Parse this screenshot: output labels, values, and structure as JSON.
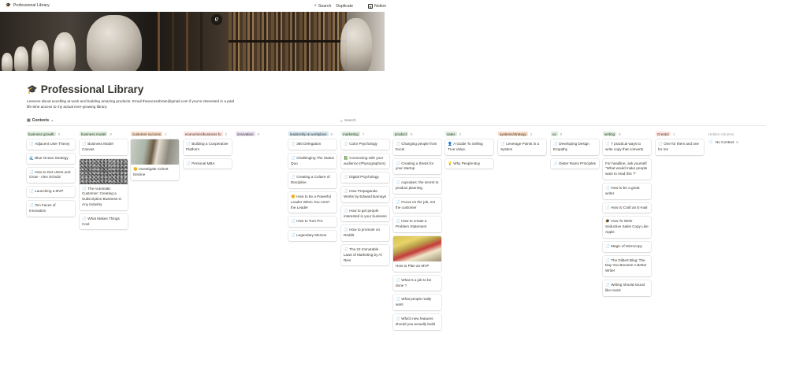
{
  "topbar": {
    "page_title": "Professional Library",
    "search": "Search",
    "duplicate": "Duplicate",
    "notion": "Notion"
  },
  "page": {
    "title": "Professional Library",
    "description": "Lessons about excelling at work and building amazing products. Email theexcessbrain@gmail.com if you're interested in a paid life-time access to my actual ever-growing library."
  },
  "view": {
    "label": "Contexts",
    "search": "Search"
  },
  "columns": [
    {
      "name": "business growth",
      "count": "3",
      "color": "#dbeddb",
      "cards": [
        {
          "text": "Adjacent User Theory",
          "icon": "page"
        },
        {
          "text": "Blue Ocean Strategy",
          "icon": "wave"
        },
        {
          "text": "How to Get Users and Grow - Alex Schultz",
          "icon": "page"
        },
        {
          "text": "Launching a MVP",
          "icon": "page"
        },
        {
          "text": "Ten Faces of Innovation",
          "icon": "page"
        }
      ]
    },
    {
      "name": "business model",
      "count": "3",
      "color": "#dbeddb",
      "cards": [
        {
          "text": "Business Model Canvas",
          "icon": "page"
        },
        {
          "text": "The Automatic Customer: Creating a Subscription Business in Any Industry",
          "icon": "page",
          "image": "gravel"
        },
        {
          "text": "What Makes Things Cool",
          "icon": "page"
        }
      ]
    },
    {
      "name": "customer success",
      "count": "1",
      "color": "#fadec9",
      "cards": [
        {
          "text": "Investigate Cohort Decline",
          "icon": "smile",
          "image": "money"
        }
      ]
    },
    {
      "name": "economics/business fu",
      "count": "2",
      "color": "#ffe2dd",
      "cards": [
        {
          "text": "Building a Cooperative Platform",
          "icon": "page"
        },
        {
          "text": "Personal MBA",
          "icon": "page"
        }
      ]
    },
    {
      "name": "innovation",
      "count": "0",
      "color": "#e8deee",
      "cards": []
    },
    {
      "name": "leadership & workplace",
      "count": "6",
      "color": "#d3e5ef",
      "cards": [
        {
          "text": "360 Delegation",
          "icon": "page"
        },
        {
          "text": "Challenging The Status Quo",
          "icon": "page"
        },
        {
          "text": "Creating a Culture of Discipline",
          "icon": "page"
        },
        {
          "text": "How to be a Powerful Leader When You Aren't the Leader",
          "icon": "fist"
        },
        {
          "text": "How to Turn Pro",
          "icon": "page"
        },
        {
          "text": "Legendary Memos",
          "icon": "page"
        }
      ]
    },
    {
      "name": "marketing",
      "count": "7",
      "color": "#dbeddb",
      "cards": [
        {
          "text": "Color Psychology",
          "icon": "page"
        },
        {
          "text": "Connecting with your audience (Physographics)",
          "icon": "book"
        },
        {
          "text": "Digital Psychology",
          "icon": "page"
        },
        {
          "text": "How Propaganda Works by Edward Barnays",
          "icon": "page"
        },
        {
          "text": "How to get people interested in your business",
          "icon": "page"
        },
        {
          "text": "How to promote on Reddit",
          "icon": "page"
        },
        {
          "text": "The 22 Immutable Laws of Marketing by Al Ries",
          "icon": "page"
        }
      ]
    },
    {
      "name": "product",
      "count": "9",
      "color": "#dbeddb",
      "cards": [
        {
          "text": "Changing people from Excel",
          "icon": "page"
        },
        {
          "text": "Creating a thesis for your startup",
          "icon": "page"
        },
        {
          "text": "cupcakes: the secret to product planning",
          "icon": "page"
        },
        {
          "text": "Focus on the job, not the customer",
          "icon": "page"
        },
        {
          "text": "How to create a Problem Statement",
          "icon": "page"
        },
        {
          "text": "How to Plan an MVP",
          "icon": "",
          "image": "street"
        },
        {
          "text": "What is a job to be done ?",
          "icon": "page"
        },
        {
          "text": "What people really want",
          "icon": "page"
        },
        {
          "text": "Which new features should you actually build",
          "icon": "page"
        }
      ]
    },
    {
      "name": "sales",
      "count": "2",
      "color": "#dbeddb",
      "cards": [
        {
          "text": "A Guide To Selling True Value.",
          "icon": "person"
        },
        {
          "text": "Why People Buy",
          "icon": "bulb"
        }
      ]
    },
    {
      "name": "systems/strategy",
      "count": "1",
      "color": "#fadec9",
      "cards": [
        {
          "text": "Leverage Points in a System",
          "icon": "page"
        }
      ]
    },
    {
      "name": "ux",
      "count": "2",
      "color": "#dbeddb",
      "cards": [
        {
          "text": "Developing Design Empathy",
          "icon": "page"
        },
        {
          "text": "Dieter Rams Principles",
          "icon": "page"
        }
      ]
    },
    {
      "name": "writing",
      "count": "8",
      "color": "#dbeddb",
      "cards": [
        {
          "text": "7 practical ways to write copy that converts",
          "icon": "page"
        },
        {
          "text": "For headline, ask yourself \"What would make people want to read this ?\"",
          "icon": ""
        },
        {
          "text": "How to be a great writer",
          "icon": "page"
        },
        {
          "text": "How to Craft an E-mail",
          "icon": "page"
        },
        {
          "text": "How To Write Seductive Sales Copy Like Apple",
          "icon": "grad"
        },
        {
          "text": "Magic of Microcopy",
          "icon": "page"
        },
        {
          "text": "The Dilbert Blog: The Day You Became A Better Writer",
          "icon": "page"
        },
        {
          "text": "Writing should sound like music",
          "icon": "page"
        }
      ]
    },
    {
      "name": "Creator",
      "count": "1",
      "color": "#ffe2dd",
      "cards": [
        {
          "text": "One for them and one for me",
          "icon": "page"
        }
      ]
    }
  ],
  "hidden": {
    "title": "Hidden columns",
    "items": [
      {
        "text": "No Context",
        "count": "8"
      }
    ]
  },
  "icons": {
    "page": "📄",
    "wave": "🌊",
    "smile": "😊",
    "fist": "✊",
    "book": "📗",
    "person": "👤",
    "bulb": "💡",
    "grad": "🎓"
  }
}
